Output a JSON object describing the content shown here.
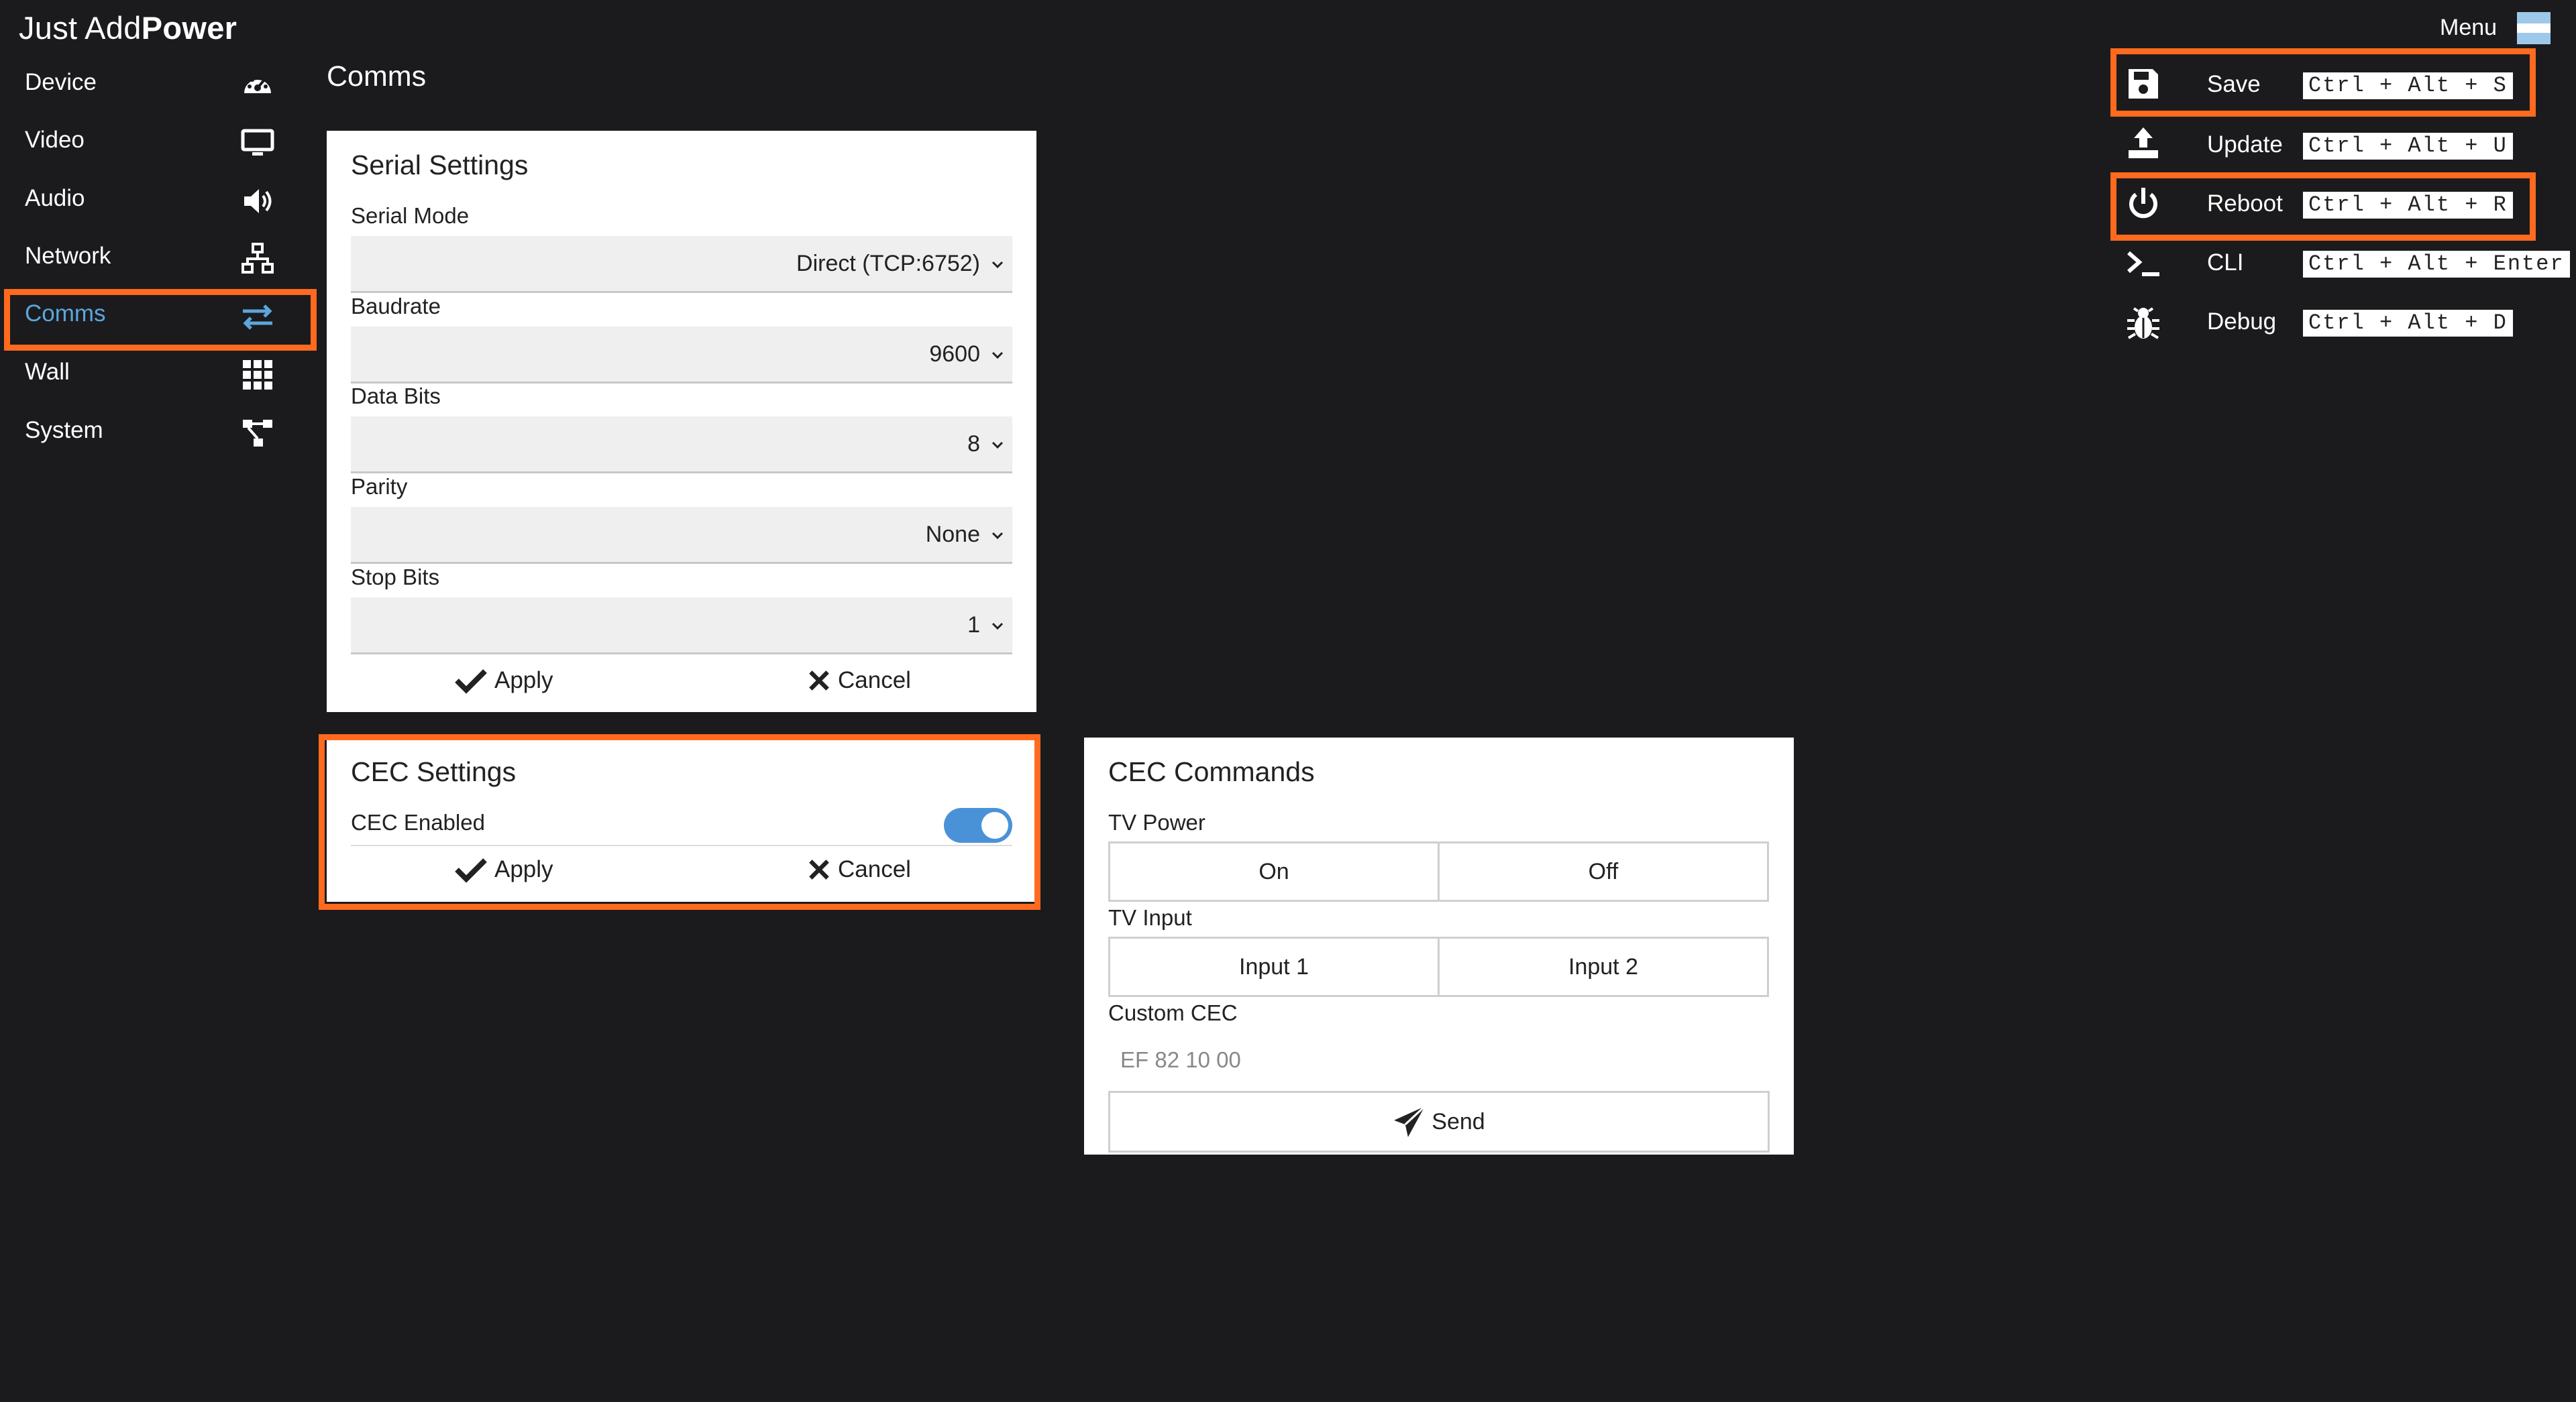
{
  "brand": {
    "light": "Just Add",
    "bold": "Power"
  },
  "sidebar": {
    "items": [
      {
        "label": "Device",
        "icon": "gauge-icon"
      },
      {
        "label": "Video",
        "icon": "monitor-icon"
      },
      {
        "label": "Audio",
        "icon": "speaker-icon"
      },
      {
        "label": "Network",
        "icon": "network-icon"
      },
      {
        "label": "Comms",
        "icon": "swap-arrows-icon",
        "active": true
      },
      {
        "label": "Wall",
        "icon": "grid-icon"
      },
      {
        "label": "System",
        "icon": "system-icon"
      }
    ]
  },
  "page": {
    "title": "Comms"
  },
  "serial": {
    "title": "Serial Settings",
    "fields": [
      {
        "label": "Serial Mode",
        "value": "Direct (TCP:6752)"
      },
      {
        "label": "Baudrate",
        "value": "9600"
      },
      {
        "label": "Data Bits",
        "value": "8"
      },
      {
        "label": "Parity",
        "value": "None"
      },
      {
        "label": "Stop Bits",
        "value": "1"
      }
    ],
    "apply": "Apply",
    "cancel": "Cancel"
  },
  "cec_settings": {
    "title": "CEC Settings",
    "enabled_label": "CEC Enabled",
    "enabled": true,
    "apply": "Apply",
    "cancel": "Cancel"
  },
  "cec_commands": {
    "title": "CEC Commands",
    "tv_power_label": "TV Power",
    "power_on": "On",
    "power_off": "Off",
    "tv_input_label": "TV Input",
    "input1": "Input 1",
    "input2": "Input 2",
    "custom_label": "Custom CEC",
    "custom_placeholder": "EF 82 10 00",
    "send": "Send"
  },
  "menu": {
    "label": "Menu",
    "items": [
      {
        "label": "Save",
        "shortcut": "Ctrl + Alt + S",
        "icon": "floppy-disk-icon"
      },
      {
        "label": "Update",
        "shortcut": "Ctrl + Alt + U",
        "icon": "upload-icon"
      },
      {
        "label": "Reboot",
        "shortcut": "Ctrl + Alt + R",
        "icon": "power-icon"
      },
      {
        "label": "CLI",
        "shortcut": "Ctrl + Alt + Enter",
        "icon": "terminal-icon"
      },
      {
        "label": "Debug",
        "shortcut": "Ctrl + Alt + D",
        "icon": "bug-icon"
      }
    ]
  },
  "colors": {
    "background": "#1b1b1d",
    "highlight": "#ff6a1f",
    "accent": "#5ba7dc",
    "toggle": "#4a92d8"
  }
}
